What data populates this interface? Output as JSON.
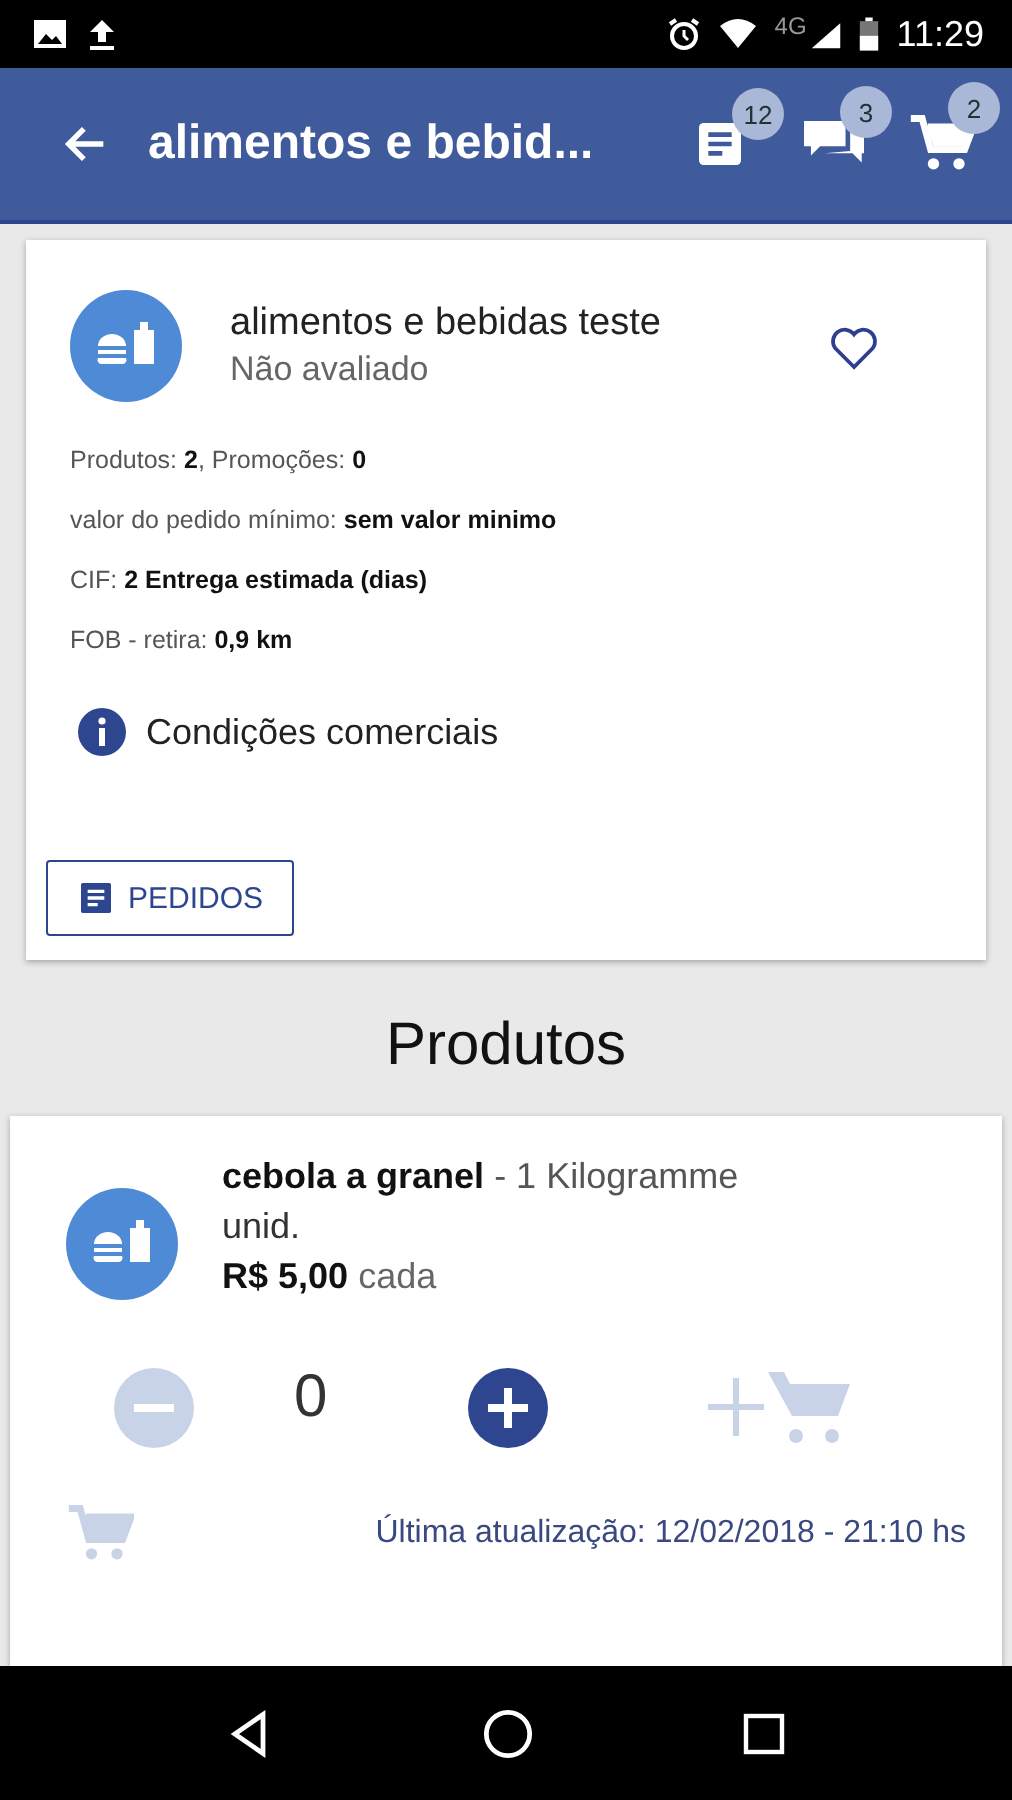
{
  "status_bar": {
    "time": "11:29",
    "network": "4G"
  },
  "app_bar": {
    "title": "alimentos e bebid...",
    "badges": [
      {
        "kind": "orders",
        "count": "12"
      },
      {
        "kind": "messages",
        "count": "3"
      },
      {
        "kind": "cart",
        "count": "2"
      }
    ]
  },
  "supplier": {
    "name": "alimentos e bebidas teste",
    "rating": "Não avaliado",
    "favorite": false,
    "details": [
      "Produtos: **2**, Promoções: **0**",
      "valor do pedido mínimo: **sem valor minimo**",
      "CIF: **2 Entrega estimada (dias)**",
      "FOB - retira: **0,9 km**"
    ],
    "conditions": "Condições comerciais",
    "orders_button": "PEDIDOS"
  },
  "section_title": "Produtos",
  "product": {
    "name": "cebola a granel",
    "unit": " - 1 Kilogramme",
    "unit_2": "unid.",
    "price": "R$ 5,00",
    "price_suffix": "cada",
    "quantity": "0",
    "decrement_disabled": true,
    "add_to_cart_disabled": true,
    "updated": "Última atualização: 12/02/2018 - 21:10 hs"
  }
}
